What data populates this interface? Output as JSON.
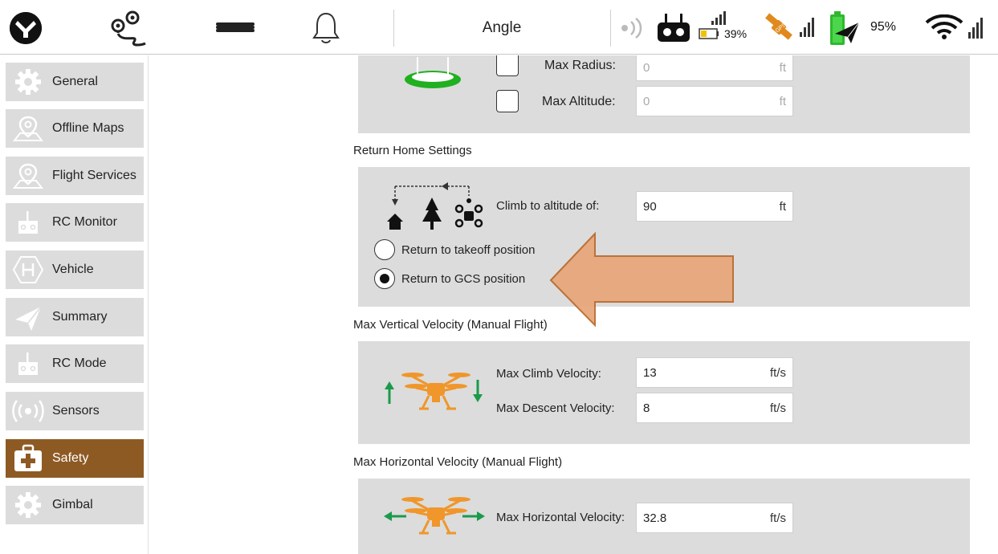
{
  "topbar": {
    "flight_mode": "Angle",
    "rc_battery_pct": "39%",
    "battery_pct": "95%",
    "colors": {
      "battery": "#2eb82e",
      "gps": "#e08a1e",
      "rc_battery": "#f2c200"
    }
  },
  "sidebar": {
    "items": [
      {
        "label": "General",
        "icon": "gear-icon"
      },
      {
        "label": "Offline Maps",
        "icon": "map-pin-icon"
      },
      {
        "label": "Flight Services",
        "icon": "map-pin-icon"
      },
      {
        "label": "RC Monitor",
        "icon": "rc-icon"
      },
      {
        "label": "Vehicle",
        "icon": "hexagon-h-icon"
      },
      {
        "label": "Summary",
        "icon": "paper-plane-icon"
      },
      {
        "label": "RC Mode",
        "icon": "rc-icon"
      },
      {
        "label": "Sensors",
        "icon": "signal-icon"
      },
      {
        "label": "Safety",
        "icon": "first-aid-icon",
        "active": true
      },
      {
        "label": "Gimbal",
        "icon": "gear-icon"
      }
    ],
    "active_color": "#8e5a24"
  },
  "geofence": {
    "max_radius_label": "Max Radius:",
    "max_radius_value": "0",
    "max_radius_unit": "ft",
    "max_altitude_label": "Max Altitude:",
    "max_altitude_value": "0",
    "max_altitude_unit": "ft"
  },
  "return_home": {
    "title": "Return Home Settings",
    "climb_label": "Climb to altitude of:",
    "climb_value": "90",
    "climb_unit": "ft",
    "option_takeoff": "Return to takeoff position",
    "option_gcs": "Return to GCS position",
    "selected": "gcs"
  },
  "vertical_velocity": {
    "title": "Max Vertical Velocity (Manual Flight)",
    "climb_label": "Max Climb Velocity:",
    "climb_value": "13",
    "climb_unit": "ft/s",
    "descent_label": "Max Descent Velocity:",
    "descent_value": "8",
    "descent_unit": "ft/s"
  },
  "horizontal_velocity": {
    "title": "Max Horizontal Velocity (Manual Flight)",
    "label": "Max Horizontal Velocity:",
    "value": "32.8",
    "unit": "ft/s"
  },
  "annotation": {
    "arrow_color": "#e8a578",
    "arrow_stroke": "#b86a2c"
  }
}
